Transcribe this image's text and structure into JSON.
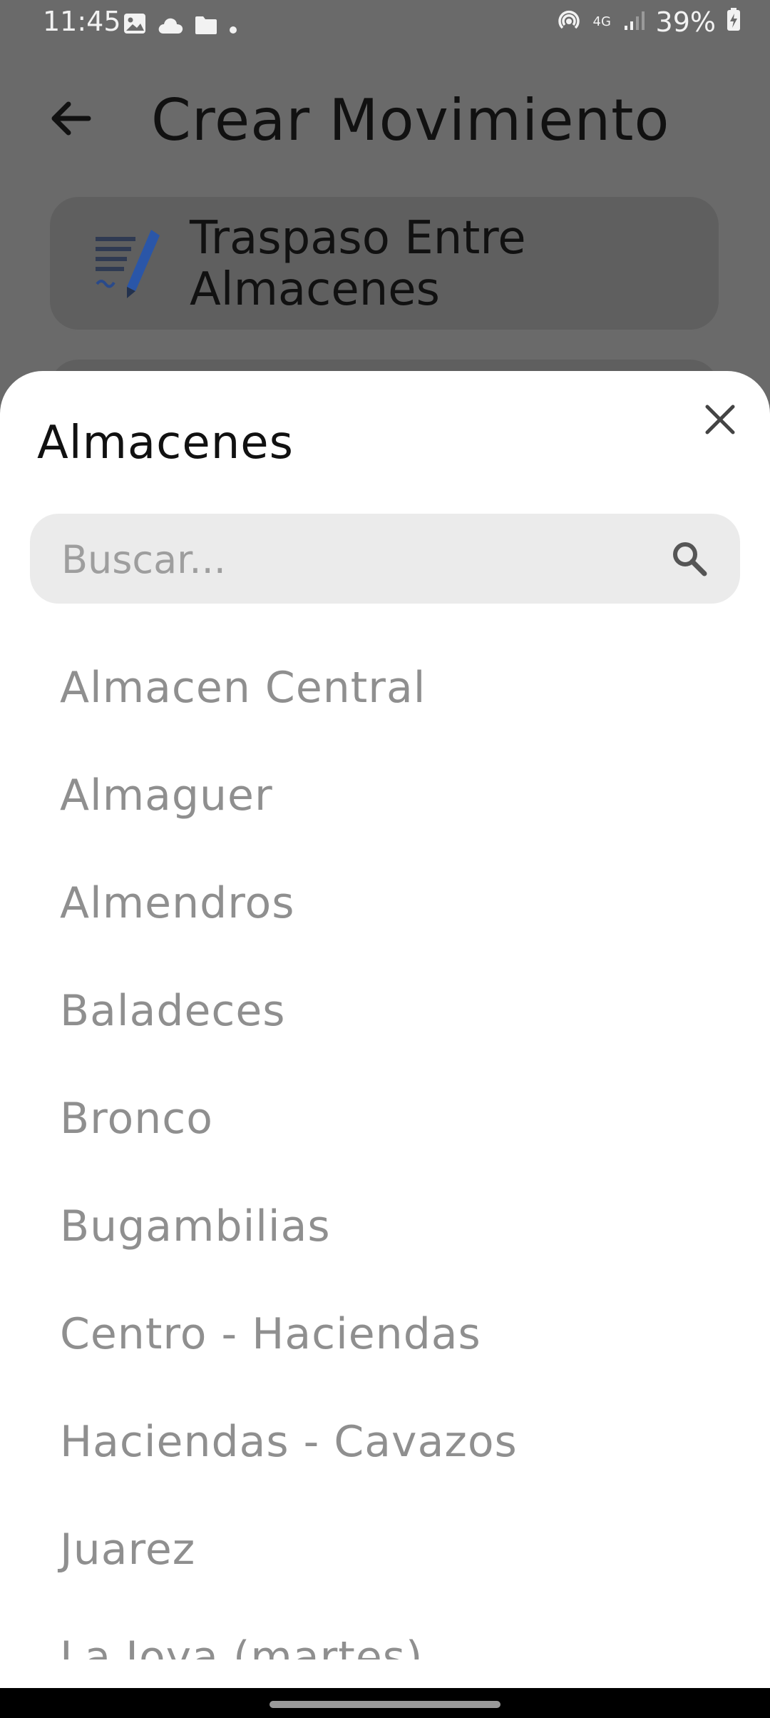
{
  "status_bar": {
    "time": "11:45",
    "battery": "39%",
    "network": "4G",
    "icons": [
      "image-icon",
      "cloud-icon",
      "folder-icon",
      "dot-icon",
      "hotspot-icon",
      "signal-icon",
      "battery-charging-icon"
    ]
  },
  "header": {
    "title": "Crear Movimiento",
    "back_icon": "arrow-back-icon"
  },
  "movement_card": {
    "label": "Traspaso Entre Almacenes",
    "icon": "document-pen-icon"
  },
  "sheet": {
    "title": "Almacenes",
    "close_icon": "close-icon",
    "search": {
      "placeholder": "Buscar...",
      "value": "",
      "icon": "search-icon"
    },
    "items": [
      "Almacen Central",
      "Almaguer",
      "Almendros",
      "Baladeces",
      "Bronco",
      "Bugambilias",
      "Centro - Haciendas",
      "Haciendas - Cavazos",
      "Juarez",
      "La Joya (martes)"
    ]
  },
  "colors": {
    "scrim": "#6a6a6a",
    "sheet_bg": "#ffffff",
    "search_bg": "#ebebeb",
    "item_text": "#8f8f8f",
    "title_text": "#111111"
  }
}
